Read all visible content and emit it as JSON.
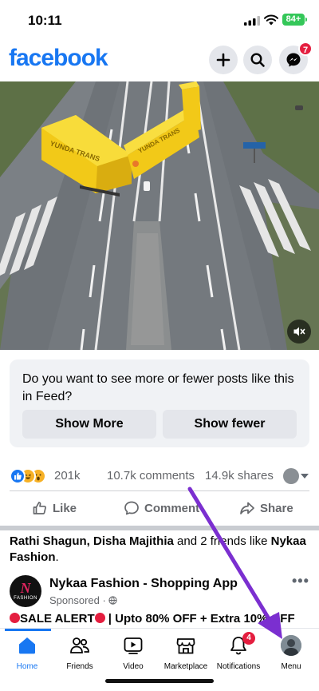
{
  "status_bar": {
    "time": "10:11",
    "battery": "84+"
  },
  "header": {
    "logo": "facebook",
    "icons": [
      "plus-icon",
      "search-icon",
      "messenger-icon"
    ],
    "messenger_badge": "7"
  },
  "video": {
    "sign_text": "YUNDA TRANS",
    "mute_icon": "speaker-muted-icon"
  },
  "feedback": {
    "question": "Do you want to see more or fewer posts like this in Feed?",
    "show_more": "Show More",
    "show_fewer": "Show fewer"
  },
  "reactions": {
    "count": "201k",
    "comments": "10.7k comments",
    "shares": "14.9k shares"
  },
  "actions": {
    "like": "Like",
    "comment": "Comment",
    "share": "Share"
  },
  "friends_like": {
    "names": "Rathi Shagun, Disha Majithia",
    "rest": " and 2 friends like ",
    "page": "Nykaa Fashion",
    "end": "."
  },
  "ad": {
    "logo_letter": "N",
    "logo_text": "FASHION",
    "name": "Nykaa Fashion - Shopping App",
    "sponsored": "Sponsored · ",
    "text_alert": "SALE ALERT",
    "text_rest": " | Upto 80% OFF + Extra 10% OFF"
  },
  "tabs": [
    {
      "label": "Home",
      "icon": "home-icon"
    },
    {
      "label": "Friends",
      "icon": "friends-icon"
    },
    {
      "label": "Video",
      "icon": "video-icon"
    },
    {
      "label": "Marketplace",
      "icon": "marketplace-icon"
    },
    {
      "label": "Notifications",
      "icon": "bell-icon",
      "badge": "4"
    },
    {
      "label": "Menu",
      "icon": "profile-avatar"
    }
  ],
  "colors": {
    "brand": "#1877f2",
    "badge_red": "#e41e3f",
    "battery_green": "#34c759",
    "annotation_arrow": "#7b2fd0",
    "truck_yellow": "#f5d020"
  }
}
